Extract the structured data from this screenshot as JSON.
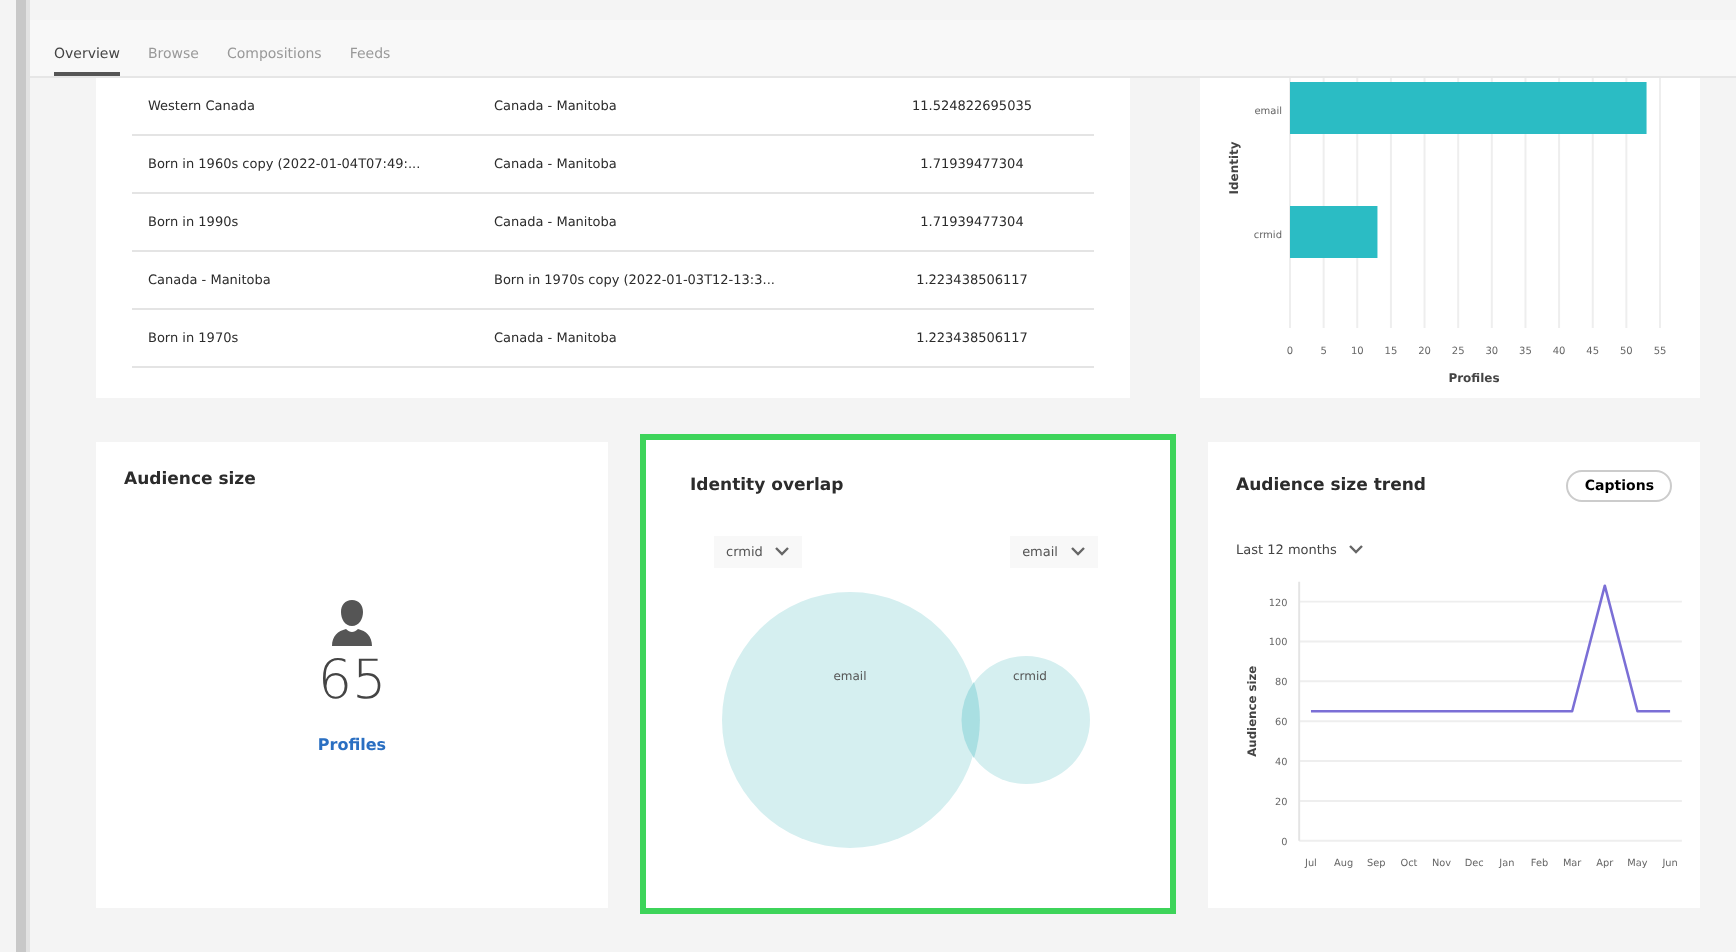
{
  "tabs": [
    {
      "label": "Overview",
      "selected": true
    },
    {
      "label": "Browse",
      "selected": false
    },
    {
      "label": "Compositions",
      "selected": false
    },
    {
      "label": "Feeds",
      "selected": false
    }
  ],
  "overlap_table": {
    "rows": [
      [
        "Western Canada",
        "Canada - Manitoba",
        "11.524822695035"
      ],
      [
        "Born in 1960s copy (2022-01-04T07:49:...",
        "Canada - Manitoba",
        "1.71939477304"
      ],
      [
        "Born in 1990s",
        "Canada - Manitoba",
        "1.71939477304"
      ],
      [
        "Canada - Manitoba",
        "Born in 1970s copy (2022-01-03T12-13:3...",
        "1.223438506117"
      ],
      [
        "Born in 1970s",
        "Canada - Manitoba",
        "1.223438506117"
      ]
    ]
  },
  "identity_chart": {
    "chart_data": {
      "type": "bar",
      "orientation": "horizontal",
      "xlabel": "Profiles",
      "ylabel": "Identity",
      "categories": [
        "email",
        "crmid"
      ],
      "grid": true,
      "series": [
        {
          "color": "#2bbcc4",
          "values": [
            53,
            13
          ]
        }
      ],
      "xlim": [
        0,
        55
      ],
      "xticks": [
        0,
        5,
        10,
        15,
        20,
        25,
        30,
        35,
        40,
        45,
        50,
        55
      ]
    }
  },
  "audience_size": {
    "title": "Audience size",
    "count": "65",
    "unit": "Profiles"
  },
  "identity_overlap": {
    "title": "Identity overlap",
    "left_select": "crmid",
    "right_select": "email",
    "venn": [
      {
        "label": "email"
      },
      {
        "label": "crmid"
      }
    ]
  },
  "audience_trend": {
    "title": "Audience size trend",
    "captions_button": "Captions",
    "range": "Last 12 months",
    "chart_data": {
      "type": "line",
      "ylabel": "Audience size",
      "categories": [
        "Jul",
        "Aug",
        "Sep",
        "Oct",
        "Nov",
        "Dec",
        "Jan",
        "Feb",
        "Mar",
        "Apr",
        "May",
        "Jun"
      ],
      "grid": true,
      "series": [
        {
          "color": "#7b6fd6",
          "values": [
            65,
            65,
            65,
            65,
            65,
            65,
            65,
            65,
            65,
            128,
            65,
            65
          ]
        }
      ],
      "ylim": [
        0,
        130
      ],
      "yticks": [
        0,
        20,
        40,
        60,
        80,
        100,
        120
      ]
    }
  }
}
